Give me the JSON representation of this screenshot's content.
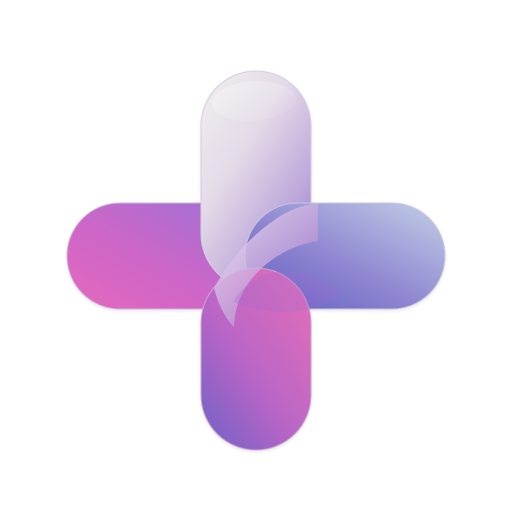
{
  "icon": {
    "name": "plus-cross-icon",
    "shape": "rounded plus sign with overlapping ribbon-like arms",
    "colors": {
      "background": "#ffffff",
      "top_arm_light": "#e4dbe8",
      "top_arm_mid": "#c7b7de",
      "left_arm_pink": "#df67bd",
      "left_arm_violet": "#a46fd1",
      "right_arm_light": "#b8c7e5",
      "right_arm_indigo": "#6c67c8",
      "bottom_arm_pink": "#d96ab9",
      "bottom_arm_violet": "#7c60c2",
      "outline": "#b8a9c9"
    }
  }
}
